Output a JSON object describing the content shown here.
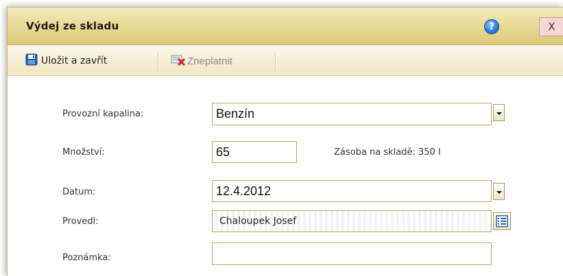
{
  "window": {
    "title": "Výdej ze skladu",
    "help_label": "?",
    "close_label": "X"
  },
  "toolbar": {
    "save_label": "Uložit a zavřít",
    "invalidate_label": "Zneplatnit"
  },
  "form": {
    "fluid_label": "Provozní kapalina:",
    "fluid_value": "Benzín",
    "quantity_label": "Množství:",
    "quantity_value": "65",
    "stock_info": "Zásoba na skladě: 350 l",
    "date_label": "Datum:",
    "date_value": "12.4.2012",
    "performed_by_label": "Provedl:",
    "performed_by_value": "Chaloupek Josef",
    "note_label": "Poznámka:",
    "note_value": ""
  },
  "icons": {
    "save": "floppy-disk-icon",
    "invalidate": "delete-red-x-icon",
    "picker": "list-picker-icon",
    "help": "help-icon"
  },
  "colors": {
    "title_gradient_top": "#f3ecc4",
    "title_gradient_bottom": "#dccb7a",
    "field_border": "#b8aa58",
    "close_bg": "#f7d7d4"
  }
}
